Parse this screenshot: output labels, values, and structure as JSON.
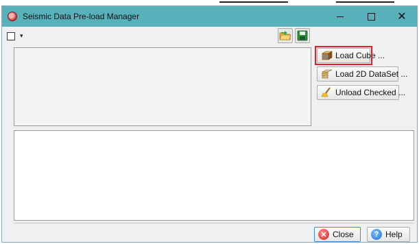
{
  "window": {
    "title": "Seismic Data Pre-load Manager"
  },
  "titlebar_controls": {
    "minimize": "–",
    "maximize": "☐",
    "close": "✕"
  },
  "toolbar": {
    "dropdown_glyph": "▾"
  },
  "side_buttons": {
    "load_cube": "Load Cube ...",
    "load_2d": "Load 2D DataSet ...",
    "unload": "Unload Checked ..."
  },
  "footer": {
    "close": "Close",
    "help": "Help",
    "close_glyph": "✕",
    "help_glyph": "?"
  },
  "icons": {
    "app": "seismic-app-icon",
    "open": "open-folder-icon",
    "save": "save-disk-icon",
    "cube": "cube-icon",
    "dataset2d": "dataset-2d-icon",
    "broom": "broom-icon"
  },
  "colors": {
    "titlebar": "#58b1ba",
    "highlight": "#e0202a",
    "close_focus": "#3b8de0"
  }
}
